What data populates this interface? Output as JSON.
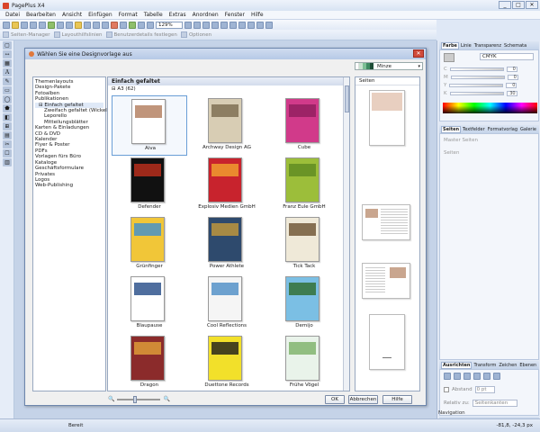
{
  "app": {
    "title": "PagePlus X4",
    "window_buttons": [
      "_",
      "□",
      "✕"
    ]
  },
  "menu": [
    "Datei",
    "Bearbeiten",
    "Ansicht",
    "Einfügen",
    "Format",
    "Tabelle",
    "Extras",
    "Anordnen",
    "Fenster",
    "Hilfe"
  ],
  "toolbar": {
    "zoom": "129%"
  },
  "toolbar2": [
    "Seiten-Manager",
    "Layouthilfslinien",
    "Benutzerdetails festlegen",
    "Optionen"
  ],
  "left_tools": [
    "▢",
    "↔",
    "▦",
    "A",
    "✎",
    "▭",
    "◯",
    "⬟",
    "◧",
    "⊞",
    "▤",
    "✂",
    "☐",
    "▥"
  ],
  "dialog": {
    "title": "Wählen Sie eine Designvorlage aus",
    "color_scheme": "Minze",
    "categories": [
      {
        "label": "Themenlayouts",
        "level": 0
      },
      {
        "label": "Design-Pakete",
        "level": 0
      },
      {
        "label": "Fotoalben",
        "level": 0
      },
      {
        "label": "Publikationen",
        "level": 0
      },
      {
        "label": "⊟ Einfach gefaltet",
        "level": 1
      },
      {
        "label": "Zweifach gefaltet (Wickelfalz)",
        "level": 2
      },
      {
        "label": "Leporello",
        "level": 2
      },
      {
        "label": "Mitteilungsblätter",
        "level": 2
      },
      {
        "label": "Karten & Einladungen",
        "level": 0
      },
      {
        "label": "CD & DVD",
        "level": 0
      },
      {
        "label": "Kalender",
        "level": 0
      },
      {
        "label": "Flyer & Poster",
        "level": 0
      },
      {
        "label": "PDFs",
        "level": 0
      },
      {
        "label": "Vorlagen fürs Büro",
        "level": 0
      },
      {
        "label": "Kataloge",
        "level": 0
      },
      {
        "label": "Geschäftsformulare",
        "level": 0
      },
      {
        "label": "Privates",
        "level": 0
      },
      {
        "label": "Logos",
        "level": 0
      },
      {
        "label": "Web-Publishing",
        "level": 0
      }
    ],
    "gallery_header": "Einfach gefaltet",
    "gallery_subheader": "⊟ A3 (62)",
    "templates": [
      {
        "name": "Aiva",
        "color": "#ffffff",
        "accent": "#b07a5a"
      },
      {
        "name": "Archway Design AG",
        "color": "#d8cdb4",
        "accent": "#7a6a4e"
      },
      {
        "name": "Cube",
        "color": "#d13a8a",
        "accent": "#8e1e5c"
      },
      {
        "name": "Defender",
        "color": "#111111",
        "accent": "#c0301d"
      },
      {
        "name": "Explosiv Medien GmbH",
        "color": "#c8232d",
        "accent": "#f2a42e"
      },
      {
        "name": "Franz Eule GmbH",
        "color": "#9cbe3a",
        "accent": "#5e8a22"
      },
      {
        "name": "Grünfinger",
        "color": "#f1c638",
        "accent": "#3e8fcf"
      },
      {
        "name": "Power Athlete",
        "color": "#2e4a6d",
        "accent": "#c59a3a"
      },
      {
        "name": "Tick Tack",
        "color": "#efe9d8",
        "accent": "#6a5030"
      },
      {
        "name": "Blaupause",
        "color": "#ffffff",
        "accent": "#234a86"
      },
      {
        "name": "Cool Reflections",
        "color": "#f5f5f5",
        "accent": "#4b8cc6"
      },
      {
        "name": "Demijo",
        "color": "#7bbfe4",
        "accent": "#2f6c2a"
      },
      {
        "name": "Dragon",
        "color": "#8b2b2b",
        "accent": "#e2a33a"
      },
      {
        "name": "Duettone Records",
        "color": "#f2e02a",
        "accent": "#1b1b1b"
      },
      {
        "name": "Frühe Vögel",
        "color": "#e9f3ea",
        "accent": "#7ab067"
      }
    ],
    "pages_label": "Seiten",
    "ok": "OK",
    "cancel": "Abbrechen",
    "help": "Hilfe"
  },
  "right_panel": {
    "color_tabs": [
      "Farbe",
      "Linie",
      "Transparenz",
      "Schemata"
    ],
    "color_model": "CMYK",
    "cmyk": [
      {
        "l": "C",
        "v": "0"
      },
      {
        "l": "M",
        "v": "0"
      },
      {
        "l": "Y",
        "v": "0"
      },
      {
        "l": "K",
        "v": "30"
      }
    ],
    "pages_tabs": [
      "Seiten",
      "Textfelder",
      "Formatvorlag",
      "Galerie"
    ],
    "master_label": "Master Seiten",
    "pages_label2": "Seiten",
    "align_tabs": [
      "Ausrichten",
      "Transform",
      "Zeichen",
      "Ebenen"
    ],
    "abstand_label": "Abstand",
    "abstand_value": "0 pt",
    "relative_label": "Relativ zu:",
    "relative_value": "Seitenkanten",
    "navigation_label": "Navigation"
  },
  "status": {
    "text": "Bereit",
    "coords": "-81,8, -24,3 px"
  }
}
